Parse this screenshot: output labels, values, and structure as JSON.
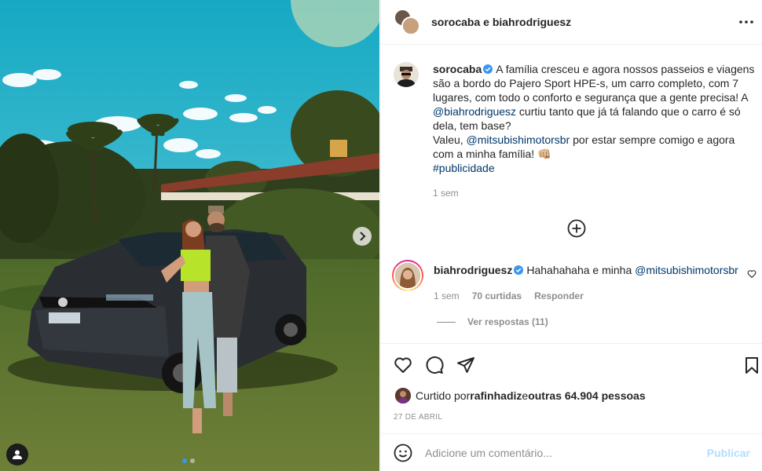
{
  "post": {
    "header_title": "sorocaba e biahrodriguesz",
    "caption": {
      "username": "sorocaba",
      "text_1": "A família cresceu e agora nossos passeios e viagens são a bordo do Pajero Sport HPE-s, um carro completo, com 7 lugares, com todo o conforto e segurança que a gente precisa! A ",
      "mention_1": "@biahrodriguesz",
      "text_2": " curtiu tanto que já tá falando que o carro é só dela, tem base?",
      "text_3": "Valeu, ",
      "mention_2": "@mitsubishimotorsbr",
      "text_4": " por estar sempre comigo e agora com a minha família! 👊🏼",
      "hashtag": "#publicidade",
      "time": "1 sem"
    },
    "comment": {
      "username": "biahrodriguesz",
      "text": "Hahahahaha e minha ",
      "mention": "@mitsubishimotorsbr",
      "time": "1 sem",
      "likes": "70 curtidas",
      "reply_label": "Responder",
      "view_replies": "Ver respostas (11)"
    },
    "likes_line": {
      "prefix": "Curtido por ",
      "user": "rafinhadiz",
      "middle": " e ",
      "others": "outras 64.904 pessoas"
    },
    "date": "27 DE ABRIL",
    "add_comment": {
      "placeholder": "Adicione um comentário...",
      "publish_label": "Publicar"
    }
  },
  "carousel": {
    "slides": 2,
    "current": 1
  },
  "colors": {
    "verified": "#3897f0",
    "mention": "#00376b",
    "muted": "#8e8e8e",
    "publish_disabled": "#b2dffc"
  },
  "icons": [
    "next-arrow-icon",
    "user-tag-icon",
    "more-options-icon",
    "verified-icon",
    "add-circle-icon",
    "heart-icon",
    "comment-icon",
    "share-icon",
    "bookmark-icon",
    "emoji-icon"
  ]
}
